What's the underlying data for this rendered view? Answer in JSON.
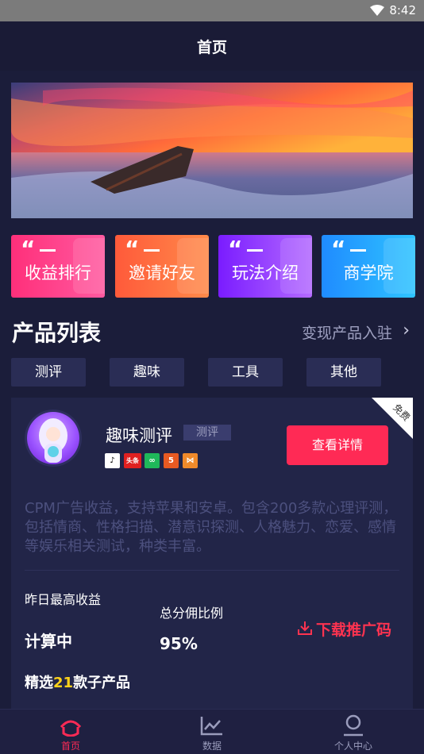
{
  "status_bar": {
    "time": "8:42",
    "wifi_icon": "wifi-icon"
  },
  "header": {
    "title": "首页"
  },
  "banner": {
    "image": "seascape-sunset-pier"
  },
  "quick_tiles": [
    {
      "label": "收益排行",
      "color_from": "#ff2f7a",
      "color_to": "#ff5aa0"
    },
    {
      "label": "邀请好友",
      "color_from": "#ff5a3a",
      "color_to": "#ff8a4a"
    },
    {
      "label": "玩法介绍",
      "color_from": "#7a1cff",
      "color_to": "#b46bff"
    },
    {
      "label": "商学院",
      "color_from": "#1f8bff",
      "color_to": "#2fc4ff"
    }
  ],
  "products_section": {
    "title": "产品列表",
    "link_label": "变现产品入驻",
    "chips": [
      "测评",
      "趣味",
      "工具",
      "其他"
    ]
  },
  "product_card": {
    "badge": "免费",
    "name": "趣味测评",
    "tag": "测评",
    "platform_icons": [
      "tiktok-icon",
      "toutiao-icon",
      "wechat-mini-icon",
      "html5-icon",
      "kuaishou-icon"
    ],
    "platform_toutiao_text": "头条",
    "detail_button": "查看详情",
    "description": "CPM广告收益，支持苹果和安卓。包含200多款心理评测，包括情商、性格扫描、潜意识探测、人格魅力、恋爱、感情等娱乐相关测试，种类丰富。",
    "yesterday_label": "昨日最高收益",
    "yesterday_value": "计算中",
    "commission_label": "总分佣比例",
    "commission_value": "95%",
    "download_label": "下载推广码",
    "selected_prefix": "精选",
    "selected_count": "21",
    "selected_suffix": "款子产品"
  },
  "tab_bar": {
    "items": [
      {
        "label": "首页",
        "icon": "home-icon",
        "active": true
      },
      {
        "label": "数据",
        "icon": "chart-icon",
        "active": false
      },
      {
        "label": "个人中心",
        "icon": "user-icon",
        "active": false
      }
    ],
    "active_color": "#ff2a55",
    "inactive_color": "#9a9cbc"
  }
}
